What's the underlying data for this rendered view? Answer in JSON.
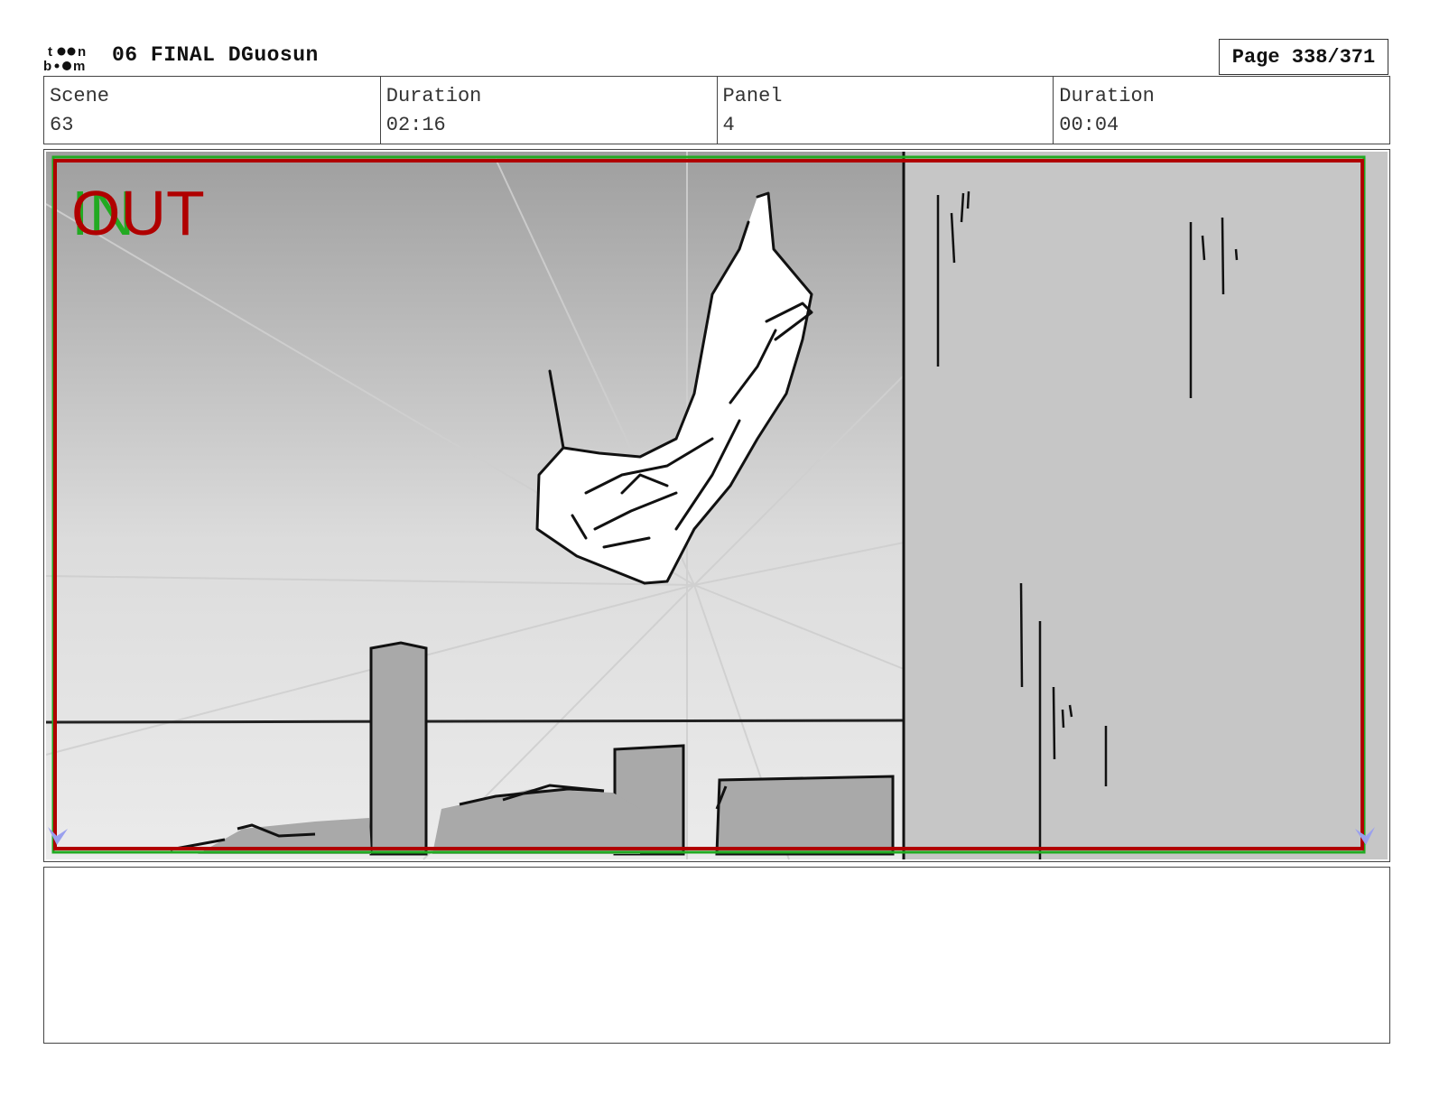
{
  "header": {
    "logo_text": "toon boom",
    "title": "06 FINAL DGuosun",
    "page": "Page 338/371"
  },
  "info": {
    "scene_label": "Scene",
    "scene_value": "63",
    "scene_duration_label": "Duration",
    "scene_duration_value": "02:16",
    "panel_label": "Panel",
    "panel_value": "4",
    "panel_duration_label": "Duration",
    "panel_duration_value": "00:04"
  },
  "panel": {
    "in_label": "IN",
    "out_label": "OUT",
    "frame_colors": {
      "out_border": "#b00000",
      "in_border": "#22aa22"
    }
  },
  "notes": {
    "text": ""
  }
}
